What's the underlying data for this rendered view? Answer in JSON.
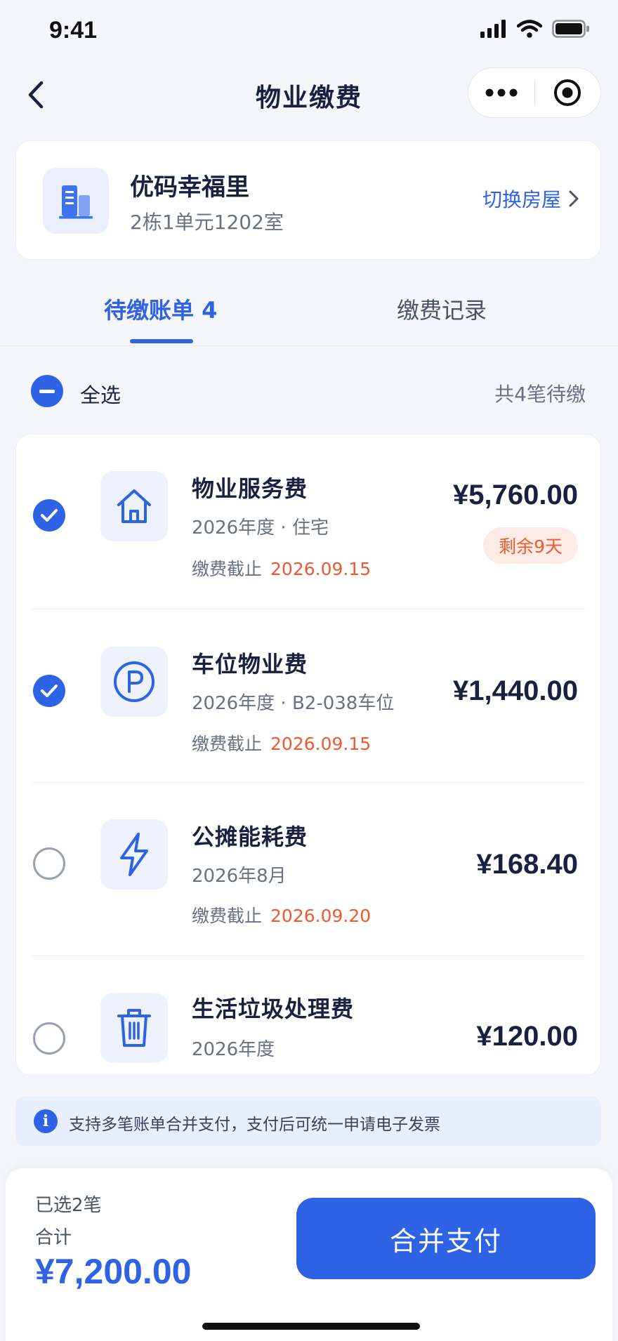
{
  "status_bar": {
    "time": "9:41",
    "icons": [
      "signal-icon",
      "wifi-icon",
      "battery-icon"
    ]
  },
  "nav": {
    "title": "物业缴费",
    "back_icon": "chevron-left-icon",
    "capsule_icons": [
      "more-dots-icon",
      "target-icon"
    ]
  },
  "house": {
    "icon": "building-icon",
    "name": "优码幸福里",
    "address": "2栋1单元1202室",
    "switch_label": "切换房屋"
  },
  "tabs": [
    {
      "label": "待缴账单 4",
      "active": true
    },
    {
      "label": "缴费记录",
      "active": false
    }
  ],
  "selection": {
    "select_all_label": "全选",
    "pending_count": "共4笔待缴"
  },
  "bills": [
    {
      "icon": "house-icon",
      "name": "物业服务费",
      "subtitle": "2026年度 · 住宅",
      "due_label": "缴费截止",
      "due_date": "2026.09.15",
      "amount": "¥5,760.00",
      "badge": "剩余9天",
      "checked": true
    },
    {
      "icon": "parking-icon",
      "name": "车位物业费",
      "subtitle": "2026年度 · B2-038车位",
      "due_label": "缴费截止",
      "due_date": "2026.09.15",
      "amount": "¥1,440.00",
      "badge": "",
      "checked": true
    },
    {
      "icon": "lightning-icon",
      "name": "公摊能耗费",
      "subtitle": "2026年8月",
      "due_label": "缴费截止",
      "due_date": "2026.09.20",
      "amount": "¥168.40",
      "badge": "",
      "checked": false
    },
    {
      "icon": "trash-icon",
      "name": "生活垃圾处理费",
      "subtitle": "2026年度",
      "due_label": "",
      "due_date": "",
      "amount": "¥120.00",
      "badge": "",
      "checked": false
    }
  ],
  "tip": {
    "icon": "info-icon",
    "text": "支持多笔账单合并支付，支付后可统一申请电子发票"
  },
  "footer": {
    "selected_count": "已选2笔",
    "total_label": "合计",
    "total_amount": "¥7,200.00",
    "pay_button": "合并支付"
  },
  "colors": {
    "primary": "#2f63e6",
    "warning": "#ee5a2f",
    "text": "#1a2140",
    "muted": "#6b7185",
    "background": "#f4f6fb"
  }
}
